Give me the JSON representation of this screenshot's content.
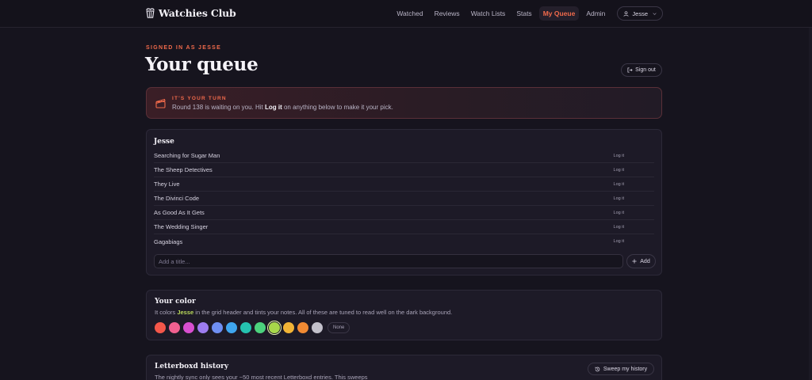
{
  "app": {
    "name": "Watchies Club"
  },
  "nav": {
    "items": [
      "Watched",
      "Reviews",
      "Watch Lists",
      "Stats",
      "My Queue",
      "Admin"
    ],
    "active": "My Queue",
    "user_label": "Jesse"
  },
  "header": {
    "eyebrow": "SIGNED IN AS JESSE",
    "title": "Your queue",
    "signout_label": "Sign out"
  },
  "turn_banner": {
    "eyebrow": "IT'S YOUR TURN",
    "text_before": "Round 138 is waiting on you. Hit ",
    "text_bold": "Log it",
    "text_after": " on anything below to make it your pick."
  },
  "queue": {
    "owner": "Jesse",
    "log_label": "Log it",
    "items": [
      "Searching for Sugar Man",
      "The Sheep Detectives",
      "They Live",
      "The Divinci Code",
      "As Good As It Gets",
      "The Wedding Singer",
      "Gagabiags"
    ],
    "add_placeholder": "Add a title...",
    "add_label": "Add"
  },
  "color_picker": {
    "title": "Your color",
    "desc_before": "It colors ",
    "desc_name": "Jesse",
    "desc_after": " in the grid header and tints your notes. All of these are tuned to read well on the dark background.",
    "swatches": [
      "#f4574a",
      "#f06090",
      "#d84fd0",
      "#9d7cf0",
      "#6f8ff3",
      "#3fa6ef",
      "#25c2b0",
      "#4cd27d",
      "#a8d84a",
      "#f2b436",
      "#f18a33",
      "#c3c1cb"
    ],
    "selected_index": 8,
    "none_label": "None"
  },
  "history": {
    "title": "Letterboxd history",
    "desc": "The nightly sync only sees your ~50 most recent Letterboxd entries. This sweeps",
    "sweep_label": "Sweep my history"
  },
  "colors": {
    "accent": "#f06a4b",
    "background": "#16141e",
    "card": "#1d1a27"
  }
}
